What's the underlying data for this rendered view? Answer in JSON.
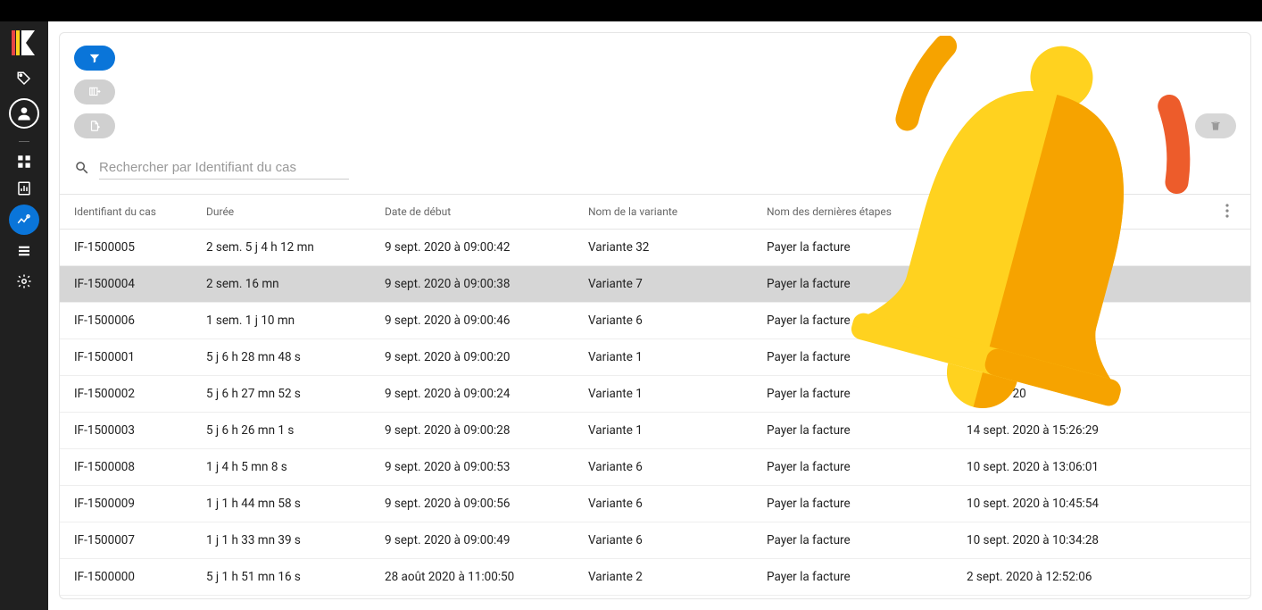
{
  "search": {
    "placeholder": "Rechercher par Identifiant du cas"
  },
  "columns": [
    "Identifiant du cas",
    "Durée",
    "Date de début",
    "Nom de la variante",
    "Nom des dernières étapes",
    ""
  ],
  "rows": [
    {
      "id": "IF-1500005",
      "duration": "2 sem. 5 j 4 h 12 mn",
      "start": "9 sept. 2020 à 09:00:42",
      "variant": "Variante 32",
      "last_step": "Payer la facture",
      "col5": "",
      "highlight": false
    },
    {
      "id": "IF-1500004",
      "duration": "2 sem. 16 mn",
      "start": "9 sept. 2020 à 09:00:38",
      "variant": "Variante 7",
      "last_step": "Payer la facture",
      "col5": "",
      "highlight": true
    },
    {
      "id": "IF-1500006",
      "duration": "1 sem. 1 j 10 mn",
      "start": "9 sept. 2020 à 09:00:46",
      "variant": "Variante 6",
      "last_step": "Payer la facture",
      "col5": "",
      "highlight": false
    },
    {
      "id": "IF-1500001",
      "duration": "5 j 6 h 28 mn 48 s",
      "start": "9 sept. 2020 à 09:00:20",
      "variant": "Variante 1",
      "last_step": "Payer la facture",
      "col5": "",
      "highlight": false
    },
    {
      "id": "IF-1500002",
      "duration": "5 j 6 h 27 mn 52 s",
      "start": "9 sept. 2020 à 09:00:24",
      "variant": "Variante 1",
      "last_step": "Payer la facture",
      "col5": "14 sept. 20",
      "highlight": false
    },
    {
      "id": "IF-1500003",
      "duration": "5 j 6 h 26 mn 1 s",
      "start": "9 sept. 2020 à 09:00:28",
      "variant": "Variante 1",
      "last_step": "Payer la facture",
      "col5": "14 sept. 2020 à 15:26:29",
      "highlight": false
    },
    {
      "id": "IF-1500008",
      "duration": "1 j 4 h 5 mn 8 s",
      "start": "9 sept. 2020 à 09:00:53",
      "variant": "Variante 6",
      "last_step": "Payer la facture",
      "col5": "10 sept. 2020 à 13:06:01",
      "highlight": false
    },
    {
      "id": "IF-1500009",
      "duration": "1 j 1 h 44 mn 58 s",
      "start": "9 sept. 2020 à 09:00:56",
      "variant": "Variante 6",
      "last_step": "Payer la facture",
      "col5": "10 sept. 2020 à 10:45:54",
      "highlight": false
    },
    {
      "id": "IF-1500007",
      "duration": "1 j 1 h 33 mn 39 s",
      "start": "9 sept. 2020 à 09:00:49",
      "variant": "Variante 6",
      "last_step": "Payer la facture",
      "col5": "10 sept. 2020 à 10:34:28",
      "highlight": false
    },
    {
      "id": "IF-1500000",
      "duration": "5 j 1 h 51 mn 16 s",
      "start": "28 août 2020 à 11:00:50",
      "variant": "Variante 2",
      "last_step": "Payer la facture",
      "col5": "2 sept. 2020 à 12:52:06",
      "highlight": false
    }
  ],
  "colors": {
    "accent": "#0a75d9",
    "bell_yellow": "#ffd21f",
    "bell_orange": "#f6a300",
    "bell_red": "#ed5c2b"
  }
}
